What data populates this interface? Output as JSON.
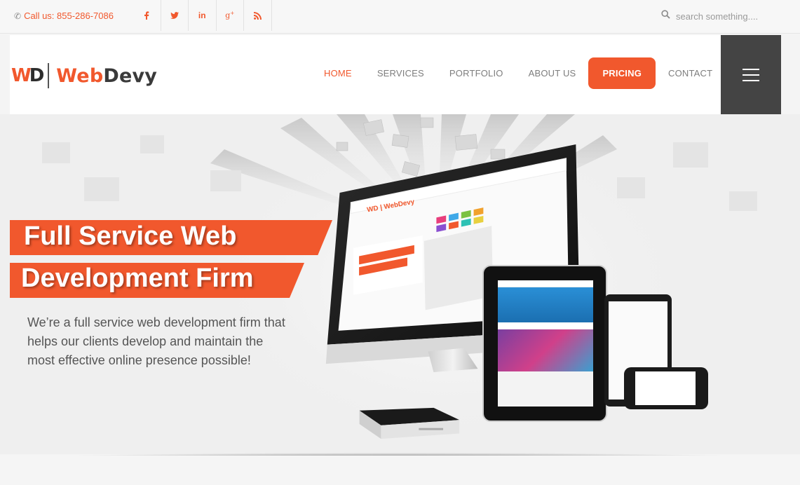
{
  "topbar": {
    "phone_label": "Call us: 855-286-7086",
    "social_icons": [
      {
        "name": "facebook-icon",
        "glyph": "f"
      },
      {
        "name": "twitter-icon",
        "glyph": "t"
      },
      {
        "name": "linkedin-icon",
        "glyph": "in"
      },
      {
        "name": "google-plus-icon",
        "glyph": "g+"
      },
      {
        "name": "rss-icon",
        "glyph": "rss"
      }
    ],
    "search_placeholder": "search something...."
  },
  "logo": {
    "mark_w": "W",
    "mark_d": "D",
    "text_web": "Web",
    "text_devy": "Devy"
  },
  "nav": {
    "items": [
      {
        "label": "HOME",
        "active": true
      },
      {
        "label": "SERVICES",
        "active": false
      },
      {
        "label": "PORTFOLIO",
        "active": false
      },
      {
        "label": "ABOUT US",
        "active": false
      },
      {
        "label": "PRICING",
        "active": false,
        "highlight": true
      },
      {
        "label": "CONTACT",
        "active": false
      }
    ]
  },
  "hero": {
    "headline_line1": "Full Service Web",
    "headline_line2": "Development Firm",
    "description": "We’re a full service web development firm that helps our clients develop and maintain the most effective online presence possible!"
  },
  "colors": {
    "accent": "#f1582d",
    "dark": "#444444",
    "text": "#555555"
  }
}
